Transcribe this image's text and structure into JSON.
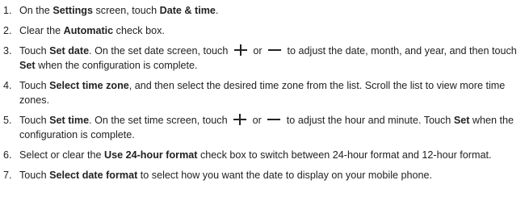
{
  "steps": [
    {
      "num": "1.",
      "parts": [
        "On the ",
        "Settings",
        " screen, touch ",
        "Date & time",
        "."
      ]
    },
    {
      "num": "2.",
      "parts": [
        "Clear the ",
        "Automatic",
        " check box."
      ]
    },
    {
      "num": "3.",
      "parts": [
        "Touch ",
        "Set date",
        ". On the set date screen, touch ",
        " or ",
        " to adjust the date, month, and year, and then touch ",
        "Set",
        " when the configuration is complete."
      ]
    },
    {
      "num": "4.",
      "parts": [
        "Touch ",
        "Select time zone",
        ", and then select the desired time zone from the list. Scroll the list to view more time zones."
      ]
    },
    {
      "num": "5.",
      "parts": [
        "Touch ",
        "Set time",
        ". On the set time screen, touch ",
        " or ",
        " to adjust the hour and minute. Touch ",
        "Set",
        " when the configuration is complete."
      ]
    },
    {
      "num": "6.",
      "parts": [
        "Select or clear the ",
        "Use 24-hour format",
        " check box to switch between 24-hour format and 12-hour format."
      ]
    },
    {
      "num": "7.",
      "parts": [
        "Touch ",
        "Select date format",
        " to select how you want the date to display on your mobile phone."
      ]
    }
  ],
  "icons": {
    "increase": "plus-icon",
    "decrease": "minus-icon"
  }
}
